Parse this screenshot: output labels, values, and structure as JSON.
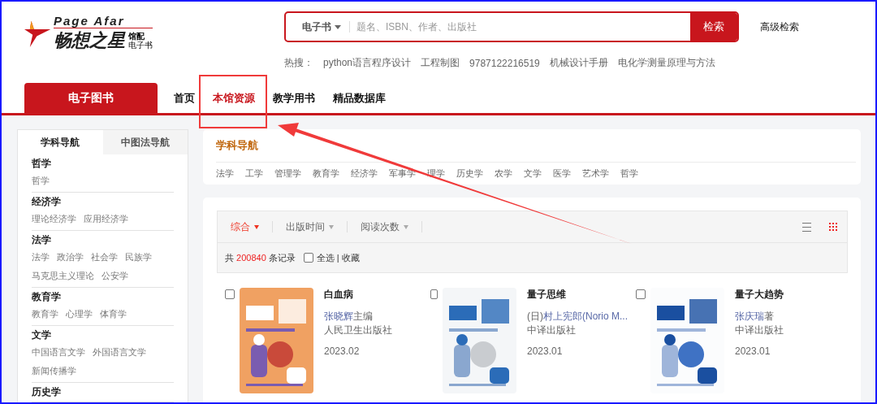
{
  "logo": {
    "latin": "Page Afar",
    "name": "畅想之星",
    "badge_top": "馆配",
    "badge_bottom": "电子书"
  },
  "search": {
    "scope": "电子书",
    "placeholder": "题名、ISBN、作者、出版社",
    "button": "检索",
    "advanced": "高级检索"
  },
  "hot": {
    "label": "热搜：",
    "terms": [
      "python语言程序设计",
      "工程制图",
      "9787122216519",
      "机械设计手册",
      "电化学测量原理与方法"
    ]
  },
  "nav": {
    "category": "电子图书",
    "items": [
      {
        "label": "首页",
        "selected": false,
        "highlighted": false
      },
      {
        "label": "本馆资源",
        "selected": true,
        "highlighted": true
      },
      {
        "label": "教学用书",
        "selected": false,
        "highlighted": false
      },
      {
        "label": "精品数据库",
        "selected": false,
        "highlighted": false
      }
    ]
  },
  "sidebar": {
    "tabs": [
      {
        "label": "学科导航",
        "selected": true
      },
      {
        "label": "中图法导航",
        "selected": false
      }
    ],
    "groups": [
      {
        "title": "哲学",
        "lines": [
          [
            "哲学"
          ]
        ]
      },
      {
        "title": "经济学",
        "lines": [
          [
            "理论经济学",
            "应用经济学"
          ]
        ]
      },
      {
        "title": "法学",
        "lines": [
          [
            "法学",
            "政治学",
            "社会学",
            "民族学"
          ],
          [
            "马克思主义理论",
            "公安学"
          ]
        ]
      },
      {
        "title": "教育学",
        "lines": [
          [
            "教育学",
            "心理学",
            "体育学"
          ]
        ]
      },
      {
        "title": "文学",
        "lines": [
          [
            "中国语言文学",
            "外国语言文学"
          ],
          [
            "新闻传播学"
          ]
        ]
      },
      {
        "title": "历史学"
      }
    ]
  },
  "subject_nav": {
    "title": "学科导航",
    "items": [
      "法学",
      "工学",
      "管理学",
      "教育学",
      "经济学",
      "军事学",
      "理学",
      "历史学",
      "农学",
      "文学",
      "医学",
      "艺术学",
      "哲学"
    ]
  },
  "sort": [
    {
      "label": "综合",
      "selected": true
    },
    {
      "label": "出版时间",
      "selected": false
    },
    {
      "label": "阅读次数",
      "selected": false
    }
  ],
  "views": [
    {
      "kind": "list",
      "selected": false
    },
    {
      "kind": "grid",
      "selected": true
    }
  ],
  "summary": {
    "prefix": "共",
    "count": "200840",
    "suffix": "条记录",
    "select_all": {
      "label": "全选",
      "checked": false
    },
    "separator": "|",
    "favorite": "收藏"
  },
  "books": [
    {
      "title": "白血病",
      "author": "张晓辉",
      "role": "主编",
      "publisher": "人民卫生出版社",
      "date": "2023.02",
      "checked": false
    },
    {
      "title": "量子思维",
      "author_prefix": "(日)",
      "author": "村上宪郎(Norio M...",
      "publisher": "中译出版社",
      "date": "2023.01",
      "checked": false
    },
    {
      "title": "量子大趋势",
      "author": "张庆瑞",
      "role": "著",
      "publisher": "中译出版社",
      "date": "2023.01",
      "checked": false
    }
  ]
}
